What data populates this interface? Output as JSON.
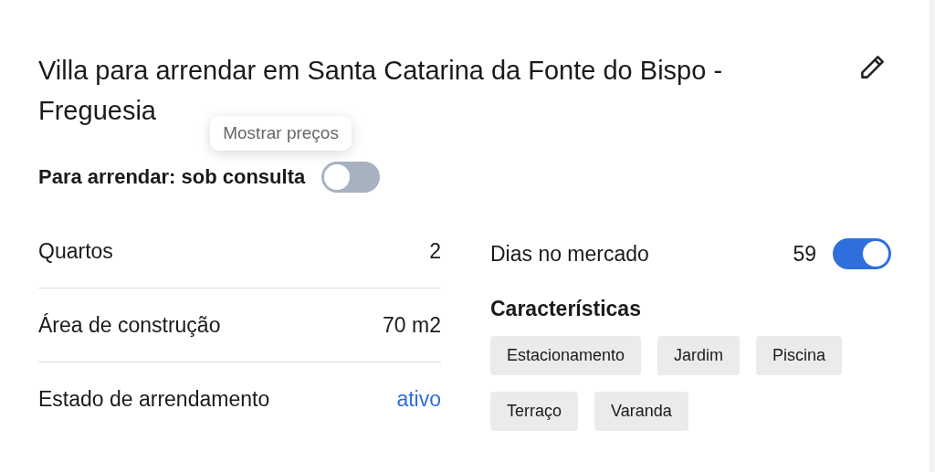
{
  "title": "Villa para arrendar em Santa Catarina da Fonte do Bispo - Freguesia",
  "price": {
    "label": "Para arrendar: sob consulta",
    "tooltip": "Mostrar preços",
    "show_prices": {
      "on": false
    }
  },
  "details": [
    {
      "label": "Quartos",
      "value": "2",
      "kind": "plain"
    },
    {
      "label": "Área de construção",
      "value": "70 m2",
      "kind": "plain"
    },
    {
      "label": "Estado de arrendamento",
      "value": "ativo",
      "kind": "link"
    }
  ],
  "market": {
    "label": "Dias no mercado",
    "value": "59",
    "on": true
  },
  "features": {
    "heading": "Características",
    "tags": [
      "Estacionamento",
      "Jardim",
      "Piscina",
      "Terraço",
      "Varanda"
    ]
  }
}
